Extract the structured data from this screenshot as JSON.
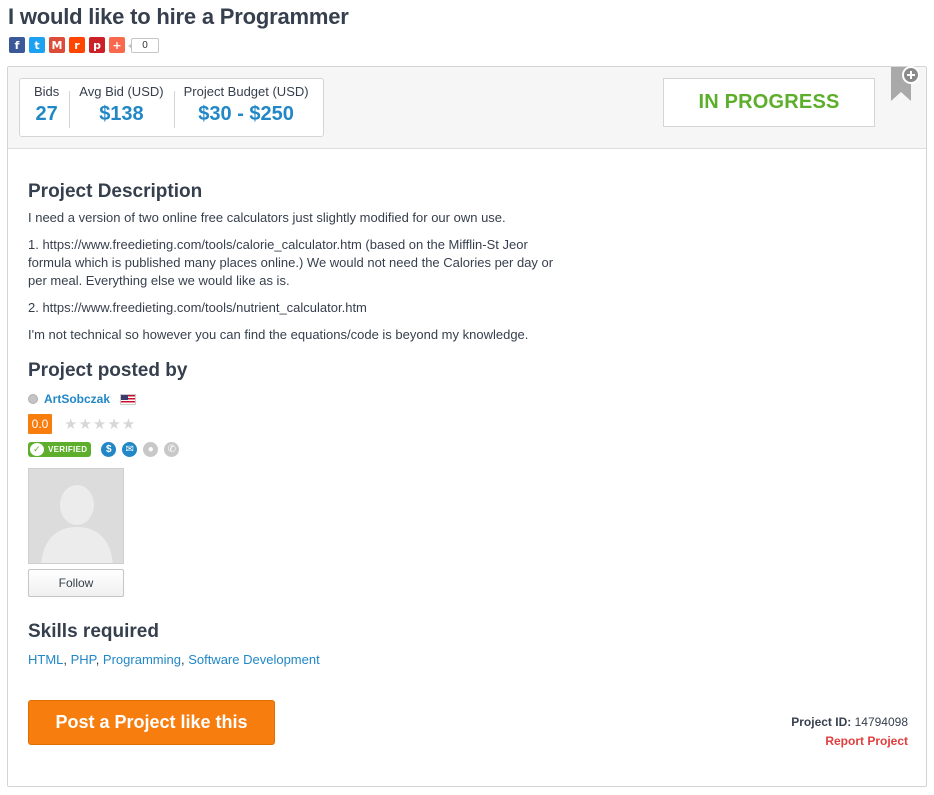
{
  "page": {
    "title": "I would like to hire a Programmer"
  },
  "share": {
    "buttons": [
      {
        "name": "facebook",
        "glyph": "f",
        "color": "#3b5998"
      },
      {
        "name": "twitter",
        "glyph": "t",
        "color": "#1da1f2"
      },
      {
        "name": "gmail",
        "glyph": "M",
        "color": "#dd4b39"
      },
      {
        "name": "reddit",
        "glyph": "r",
        "color": "#ff4500"
      },
      {
        "name": "pinterest",
        "glyph": "p",
        "color": "#cb2027"
      },
      {
        "name": "addthis",
        "glyph": "+",
        "color": "#f8694d"
      }
    ],
    "count": "0"
  },
  "stats": {
    "bids_label": "Bids",
    "bids_value": "27",
    "avg_label": "Avg Bid (USD)",
    "avg_value": "$138",
    "budget_label": "Project Budget (USD)",
    "budget_value": "$30 - $250"
  },
  "status": {
    "label": "IN PROGRESS",
    "color": "#5dae2b"
  },
  "description": {
    "title": "Project Description",
    "paragraphs": [
      "I need a version of two online free calculators just slightly modified for our own use.",
      "1. https://www.freedieting.com/tools/calorie_calculator.htm (based on the Mifflin-St Jeor formula which is published many places online.) We would not need the Calories per day or per meal. Everything else we would like as is.",
      "2. https://www.freedieting.com/tools/nutrient_calculator.htm",
      "I'm not technical so however you can find the equations/code is beyond my knowledge."
    ]
  },
  "poster": {
    "title": "Project posted by",
    "username": "ArtSobczak",
    "country_flag_icon": "us-flag-icon",
    "rating": "0.0",
    "stars": "★★★★★",
    "verified_label": "VERIFIED",
    "follow_label": "Follow"
  },
  "skills": {
    "title": "Skills required",
    "items": [
      "HTML",
      "PHP",
      "Programming",
      "Software Development"
    ]
  },
  "footer": {
    "post_button": "Post a Project like this",
    "project_id_label": "Project ID:",
    "project_id_value": "14794098",
    "report_label": "Report Project"
  },
  "colors": {
    "accent_blue": "#2187c6",
    "orange": "#f77d0e",
    "green": "#5dae2b",
    "red": "#e03e3e"
  }
}
